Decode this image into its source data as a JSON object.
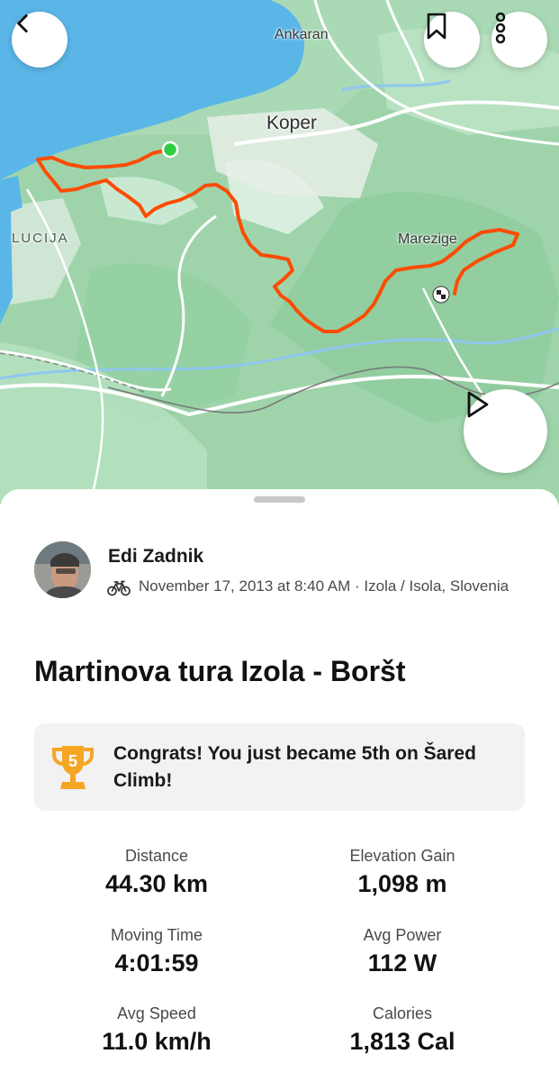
{
  "map": {
    "labels": {
      "ankaran": "Ankaran",
      "koper": "Koper",
      "lucija": "LUCIJA",
      "marezige": "Marezige"
    },
    "route_color": "#fc4c02",
    "start_color": "#2ecc40",
    "sea_color": "#5bb6e8",
    "land_color": "#a8d9b4"
  },
  "controls": {
    "back_icon": "chevron-left-icon",
    "bookmark_icon": "bookmark-icon",
    "more_icon": "more-vertical-icon",
    "play_icon": "play-icon"
  },
  "activity": {
    "athlete": "Edi Zadnik",
    "sport_icon": "bike-icon",
    "meta": "November 17, 2013 at 8:40 AM · Izola / Isola, Slovenia",
    "title": "Martinova tura Izola - Boršt",
    "achievement": {
      "rank": "5",
      "text": "Congrats! You just became 5th on Šared Climb!"
    }
  },
  "stats": {
    "distance": {
      "label": "Distance",
      "value": "44.30 km"
    },
    "elevation": {
      "label": "Elevation Gain",
      "value": "1,098 m"
    },
    "moving_time": {
      "label": "Moving Time",
      "value": "4:01:59"
    },
    "avg_power": {
      "label": "Avg Power",
      "value": "112 W"
    },
    "avg_speed": {
      "label": "Avg Speed",
      "value": "11.0 km/h"
    },
    "calories": {
      "label": "Calories",
      "value": "1,813 Cal"
    }
  }
}
